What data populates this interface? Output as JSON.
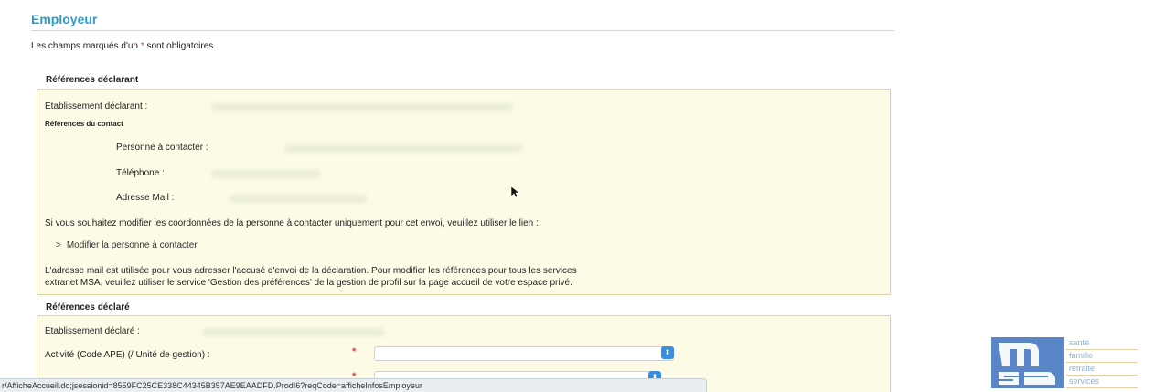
{
  "page": {
    "title": "Employeur",
    "required_note_before": "Les champs marqués d'un ",
    "required_star": "*",
    "required_note_after": " sont obligatoires"
  },
  "declarant": {
    "section_title": "Références déclarant",
    "etablissement_label": "Etablissement déclarant :",
    "contact_title": "Références du contact",
    "personne_label": "Personne à contacter :",
    "telephone_label": "Téléphone :",
    "email_label": "Adresse Mail :",
    "info_text": "Si vous souhaitez modifier les coordonnées de la personne à contacter uniquement pour cet envoi, veuillez utiliser le lien :",
    "link_chevron": ">",
    "link_label": "Modifier la personne à contacter",
    "mail_note_line1": "L'adresse mail est utilisée pour vous adresser l'accusé d'envoi de la déclaration. Pour modifier les références pour tous les services",
    "mail_note_line2": "extranet MSA, veuillez utiliser le service 'Gestion des préférences' de la gestion de profil sur la page accueil de votre espace privé."
  },
  "declare": {
    "section_title": "Références déclaré",
    "etablissement_label": "Etablissement déclaré :",
    "activite_label": "Activité (Code APE) (/ Unité de gestion) :",
    "required_star": "*",
    "activite_value": "",
    "next_required_star": "*"
  },
  "status_bar": {
    "url": "r/AfficheAccueil.do;jsessionid=8559FC25CE338C44345B357AE9EAADFD.ProdI6?reqCode=afficheInfosEmployeur"
  },
  "logo": {
    "words": [
      "santé",
      "famille",
      "retraite",
      "services"
    ],
    "brand_color": "#4f7fc4"
  }
}
